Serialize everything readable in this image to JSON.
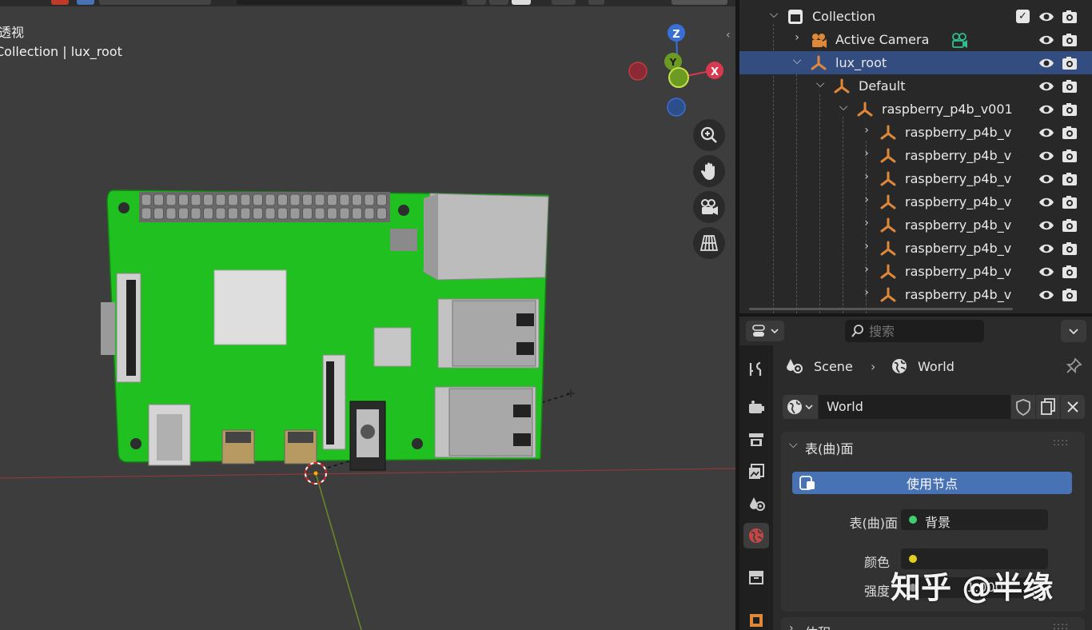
{
  "viewport": {
    "view_mode": "透视",
    "breadcrumb": "Collection | lux_root",
    "gizmo": {
      "z": "Z",
      "y": "Y",
      "x": "X"
    }
  },
  "outliner": {
    "rows": [
      {
        "label": "Collection",
        "type": "collection",
        "checkbox": "✓"
      },
      {
        "label": "Active Camera",
        "type": "camera"
      },
      {
        "label": "lux_root",
        "type": "empty",
        "selected": true
      },
      {
        "label": "Default",
        "type": "empty"
      },
      {
        "label": "raspberry_p4b_v001",
        "type": "empty"
      },
      {
        "label": "raspberry_p4b_v",
        "type": "empty"
      },
      {
        "label": "raspberry_p4b_v",
        "type": "empty"
      },
      {
        "label": "raspberry_p4b_v",
        "type": "empty"
      },
      {
        "label": "raspberry_p4b_v",
        "type": "empty"
      },
      {
        "label": "raspberry_p4b_v",
        "type": "empty"
      },
      {
        "label": "raspberry_p4b_v",
        "type": "empty"
      },
      {
        "label": "raspberry_p4b_v",
        "type": "empty"
      },
      {
        "label": "raspberry_p4b_v",
        "type": "empty"
      }
    ]
  },
  "properties": {
    "search_placeholder": "搜索",
    "breadcrumb": {
      "scene": "Scene",
      "sep": "›",
      "world": "World"
    },
    "world_name": "World",
    "surface_panel": {
      "title": "表(曲)面",
      "use_nodes": "使用节点",
      "surface_label": "表(曲)面",
      "surface_value": "背景",
      "color_label": "颜色",
      "strength_label": "强度",
      "strength_value": "1.000"
    },
    "volume_panel": {
      "title": "体积"
    }
  },
  "watermark": "知乎 @半缘",
  "colors": {
    "selection": "#334d80",
    "accent_blue": "#4772b3",
    "empty_orange": "#e0883a",
    "camera_green": "#2fbf8f",
    "pcb_green": "#1fbf1f"
  }
}
